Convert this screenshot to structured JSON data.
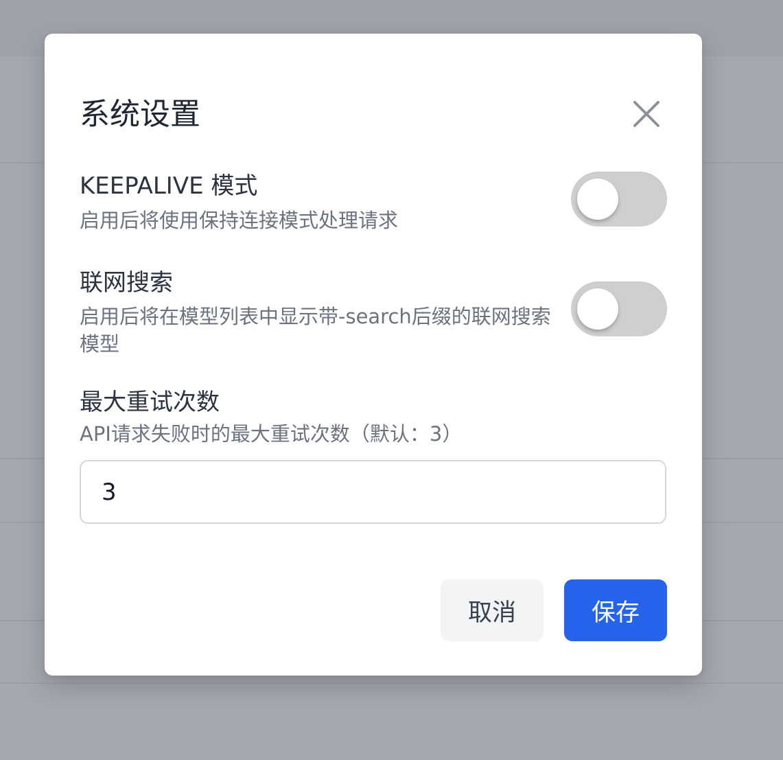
{
  "dialog": {
    "title": "系统设置",
    "close_icon": "close-icon",
    "settings": {
      "keepalive": {
        "label": "KEEPALIVE 模式",
        "description": "启用后将使用保持连接模式处理请求",
        "enabled": false
      },
      "web_search": {
        "label": "联网搜索",
        "description": "启用后将在模型列表中显示带-search后缀的联网搜索模型",
        "enabled": false
      },
      "max_retries": {
        "label": "最大重试次数",
        "description": "API请求失败时的最大重试次数（默认：3）",
        "value": "3"
      }
    },
    "buttons": {
      "cancel": "取消",
      "save": "保存"
    }
  },
  "colors": {
    "primary": "#2563eb",
    "toggle_off": "#cfcfcf",
    "overlay": "#a4a8b0"
  }
}
